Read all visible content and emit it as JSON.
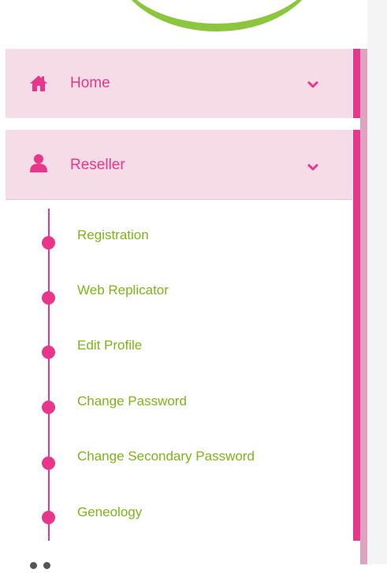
{
  "colors": {
    "accent": "#e8378a",
    "accent_light": "#dea3be",
    "menu_bg": "#f6dce6",
    "submenu_text": "#7cb518",
    "logo_green": "#8cc63f"
  },
  "menu": {
    "home": {
      "label": "Home",
      "icon": "home-icon"
    },
    "reseller": {
      "label": "Reseller",
      "icon": "user-icon"
    }
  },
  "submenu": [
    {
      "label": "Registration"
    },
    {
      "label": "Web Replicator"
    },
    {
      "label": "Edit Profile"
    },
    {
      "label": "Change Password"
    },
    {
      "label": "Change Secondary Password"
    },
    {
      "label": "Geneology"
    }
  ]
}
